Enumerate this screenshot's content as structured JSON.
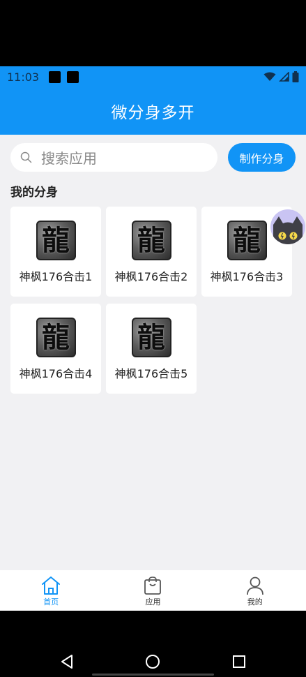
{
  "status_bar": {
    "time": "11:03"
  },
  "header": {
    "title": "微分身多开"
  },
  "search": {
    "placeholder": "搜索应用"
  },
  "make_button": {
    "label": "制作分身"
  },
  "section": {
    "title": "我的分身"
  },
  "clones": [
    {
      "name": "神枫176合击1",
      "icon_char": "龍"
    },
    {
      "name": "神枫176合击2",
      "icon_char": "龍"
    },
    {
      "name": "神枫176合击3",
      "icon_char": "龍"
    },
    {
      "name": "神枫176合击4",
      "icon_char": "龍"
    },
    {
      "name": "神枫176合击5",
      "icon_char": "龍"
    }
  ],
  "tabs": [
    {
      "label": "首页",
      "icon": "home-icon",
      "active": true
    },
    {
      "label": "应用",
      "icon": "bag-icon",
      "active": false
    },
    {
      "label": "我的",
      "icon": "person-icon",
      "active": false
    }
  ],
  "colors": {
    "primary": "#1194F6",
    "background": "#F1F1F3"
  }
}
